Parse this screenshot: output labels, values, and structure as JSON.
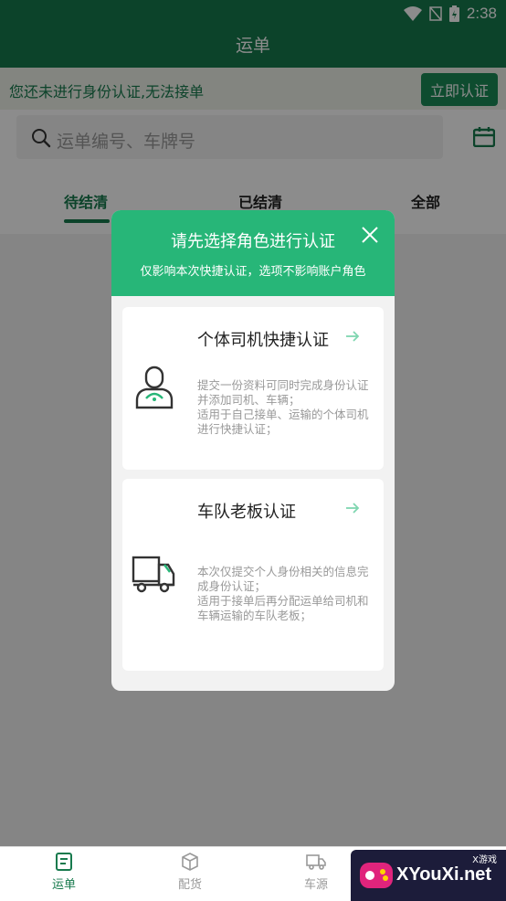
{
  "status_bar": {
    "time": "2:38"
  },
  "app": {
    "title": "运单"
  },
  "notice": {
    "text": "您还未进行身份认证,无法接单",
    "button_label": "立即认证"
  },
  "search": {
    "placeholder": "运单编号、车牌号"
  },
  "tabs": [
    {
      "label": "待结清",
      "active": true
    },
    {
      "label": "已结清",
      "active": false
    },
    {
      "label": "全部",
      "active": false
    }
  ],
  "modal": {
    "title": "请先选择角色进行认证",
    "subtitle": "仅影响本次快捷认证，选项不影响账户角色",
    "options": [
      {
        "title": "个体司机快捷认证",
        "icon": "driver-icon",
        "desc": "提交一份资料可同时完成身份认证并添加司机、车辆；\n适用于自己接单、运输的个体司机进行快捷认证；"
      },
      {
        "title": "车队老板认证",
        "icon": "truck-icon",
        "desc": "本次仅提交个人身份相关的信息完成身份认证；\n适用于接单后再分配运单给司机和车辆运输的车队老板；"
      }
    ]
  },
  "bottom_nav": [
    {
      "label": "运单",
      "icon": "waybill-icon",
      "active": true
    },
    {
      "label": "配货",
      "icon": "cube-icon",
      "active": false
    },
    {
      "label": "车源",
      "icon": "truck-icon",
      "active": false
    }
  ],
  "watermark": {
    "text": "XYouXi.net",
    "small": "X游戏"
  },
  "colors": {
    "primary": "#177a4d",
    "accent": "#27b678",
    "notice_bg": "#eef3ea"
  }
}
